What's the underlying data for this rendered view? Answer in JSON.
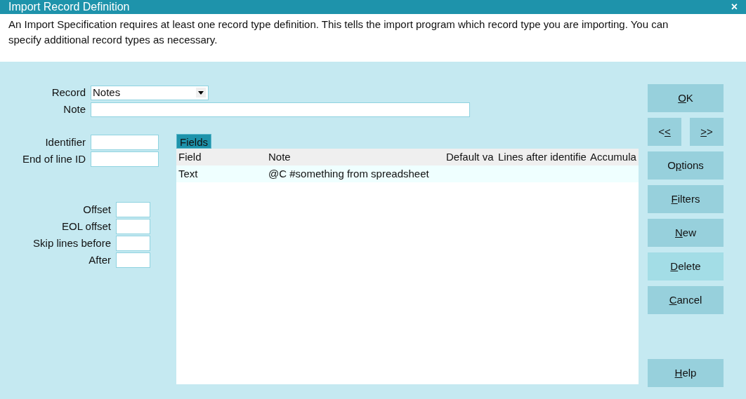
{
  "window": {
    "title": "Import Record Definition",
    "close": "×"
  },
  "description": "An Import Specification requires at least one record type definition. This tells the import program which record type you are importing. You can specify additional record types as necessary.",
  "record": {
    "label": "Record",
    "value": "Notes"
  },
  "note": {
    "label": "Note"
  },
  "id_fields": [
    {
      "label": "Identifier"
    },
    {
      "label": "End of line ID"
    }
  ],
  "offset_fields": [
    {
      "label": "Offset"
    },
    {
      "label": "EOL offset"
    },
    {
      "label": "Skip lines before"
    },
    {
      "label": "After"
    }
  ],
  "fields_tab": {
    "label": "Fields",
    "selected": true
  },
  "table": {
    "columns": [
      "Field",
      "Note",
      "Default va",
      "Lines after identifie",
      "Accumula"
    ],
    "rows": [
      [
        "Text",
        "@C #something from spreadsheet",
        null,
        null,
        null
      ]
    ]
  },
  "buttons": [
    {
      "kind": "wide",
      "key": "O",
      "after": "K",
      "highlighted": false
    },
    {
      "kind": "pair",
      "items": [
        {
          "before": "<",
          "key": "<",
          "highlighted": false
        },
        {
          "key": ">",
          "after": ">",
          "highlighted": false
        }
      ]
    },
    {
      "kind": "wide",
      "before": "O",
      "key": "p",
      "after": "tions",
      "highlighted": false
    },
    {
      "kind": "wide",
      "key": "F",
      "after": "ilters",
      "highlighted": false
    },
    {
      "kind": "wide",
      "key": "N",
      "after": "ew",
      "highlighted": false
    },
    {
      "kind": "wide",
      "key": "D",
      "after": "elete",
      "highlighted": true
    },
    {
      "kind": "wide",
      "key": "C",
      "after": "ancel",
      "highlighted": false
    },
    {
      "kind": "gap"
    },
    {
      "kind": "wide",
      "key": "H",
      "after": "elp",
      "highlighted": false
    }
  ]
}
